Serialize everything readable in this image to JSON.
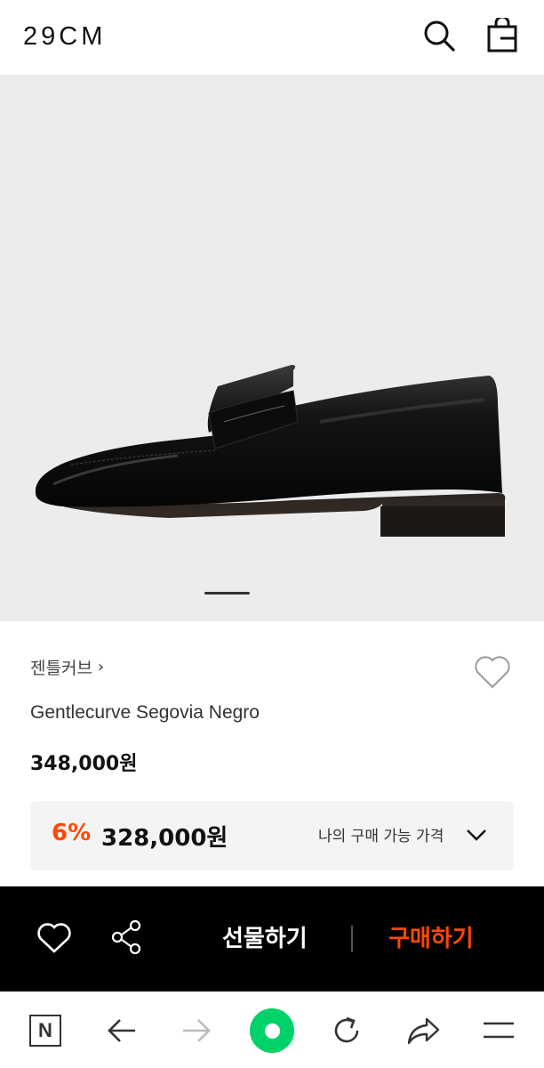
{
  "header": {
    "logo": "29CM",
    "search_icon": "search-icon",
    "bag_icon": "shopping-bag-icon"
  },
  "gallery": {
    "image_alt": "black penny loafer",
    "page_indicator": "1"
  },
  "product": {
    "brand": "젠틀커브",
    "brand_chevron": "›",
    "name": "Gentlecurve Segovia Negro",
    "price": "348,000원",
    "discount_rate": "6%",
    "discount_price": "328,000원",
    "my_price_label": "나의 구매 가능 가격"
  },
  "buybar": {
    "gift_label": "선물하기",
    "buy_label": "구매하기"
  },
  "colors": {
    "accent": "#ff4800",
    "hero_bg": "#ececec",
    "buybar_bg": "#000000",
    "green": "#00d26a"
  },
  "browser_nav": {
    "n_label": "N"
  }
}
